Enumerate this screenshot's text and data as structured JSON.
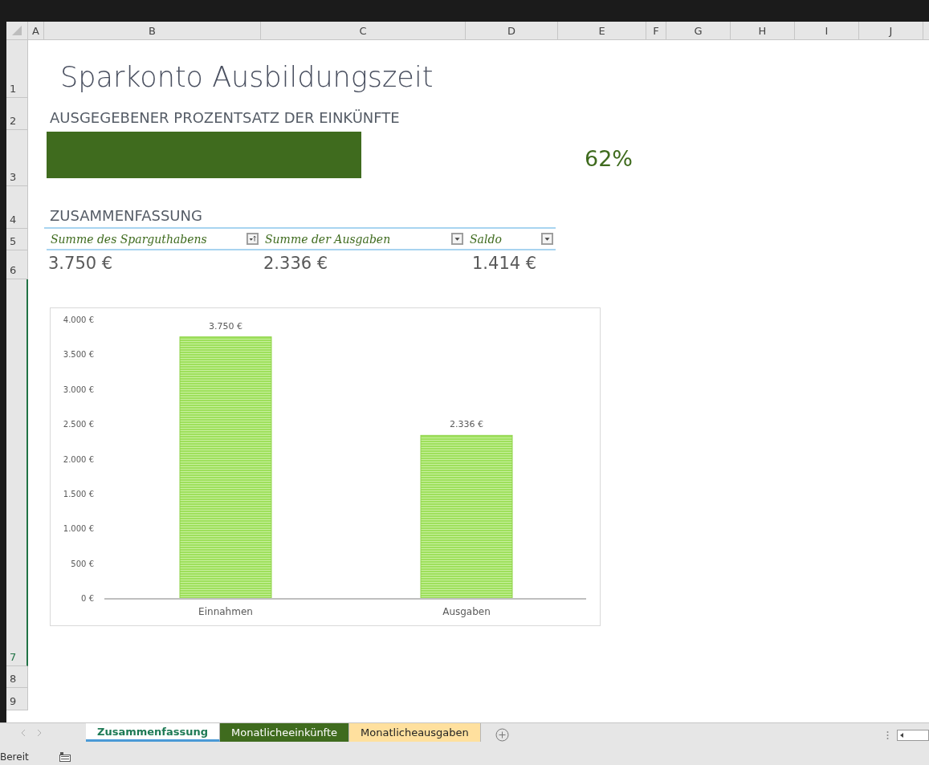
{
  "column_headers": [
    "A",
    "B",
    "C",
    "D",
    "E",
    "F",
    "G",
    "H",
    "I",
    "J"
  ],
  "row_headers": [
    "1",
    "2",
    "3",
    "4",
    "5",
    "6",
    "7",
    "8",
    "9"
  ],
  "title": "Sparkonto Ausbildungszeit",
  "subtitle": "AUSGEGEBENER PROZENTSATZ DER EINKÜNFTE",
  "percent_bar": {
    "level": 0.62
  },
  "percent": "62%",
  "summary": {
    "heading": "ZUSAMMENFASSUNG",
    "columns": [
      {
        "label": "Summe des Sparguthabens",
        "kind": "sorted"
      },
      {
        "label": "Summe der Ausgaben",
        "kind": "filter"
      },
      {
        "label": "Saldo",
        "kind": "filter"
      }
    ],
    "values": [
      "3.750 €",
      "2.336 €",
      "1.414 €"
    ]
  },
  "chart": {
    "chart_data": {
      "type": "bar",
      "categories": [
        "Einnahmen",
        "Ausgaben"
      ],
      "values": [
        3750,
        2336
      ],
      "ylim": [
        0,
        4000
      ],
      "yticks": [
        {
          "value": 0,
          "label": "0 €"
        },
        {
          "value": 500,
          "label": "500 €"
        },
        {
          "value": 1000,
          "label": "1.000 €"
        },
        {
          "value": 1500,
          "label": "1.500 €"
        },
        {
          "value": 2000,
          "label": "2.000 €"
        },
        {
          "value": 2500,
          "label": "2.500 €"
        },
        {
          "value": 3000,
          "label": "3.000 €"
        },
        {
          "value": 3500,
          "label": "3.500 €"
        },
        {
          "value": 4000,
          "label": "4.000 €"
        }
      ],
      "data_labels": true,
      "value_labels": [
        "3.750 €",
        "2.336 €"
      ]
    }
  },
  "sheet_tabs": [
    {
      "label": "Zusammenfassung",
      "selected": true,
      "color": "#ffffff"
    },
    {
      "label": "Monatlicheeinkünfte",
      "selected": false,
      "color": "#3f6b1e"
    },
    {
      "label": "Monatlicheausgaben",
      "selected": false,
      "color": "#ffe09e"
    }
  ],
  "status_bar": {
    "text": "Bereit"
  }
}
